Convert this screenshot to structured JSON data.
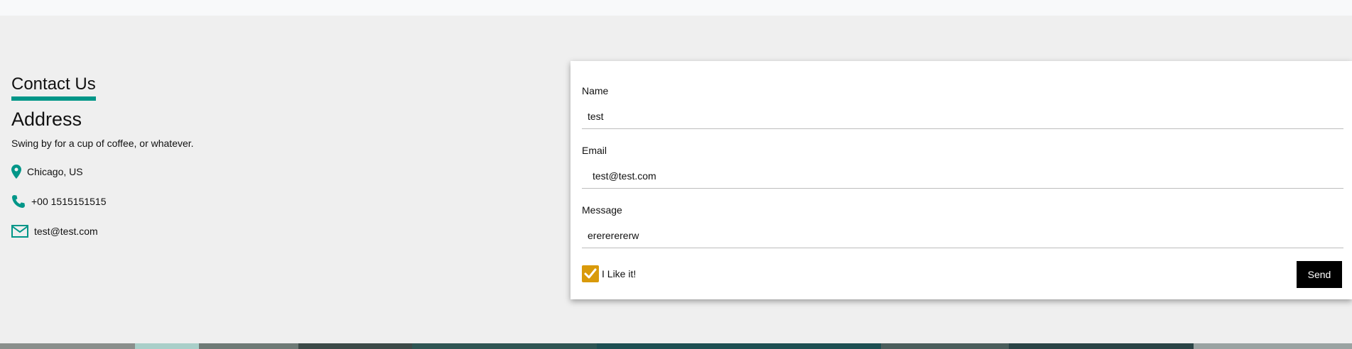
{
  "contact": {
    "title": "Contact Us",
    "address_heading": "Address",
    "address_text": "Swing by for a cup of coffee, or whatever.",
    "location": "Chicago, US",
    "phone": "+00 1515151515",
    "email": "test@test.com"
  },
  "form": {
    "name_label": "Name",
    "name_value": "test",
    "email_label": "Email",
    "email_value": "test@test.com",
    "message_label": "Message",
    "message_value": "erererererw",
    "checkbox_label": "I Like it!",
    "checkbox_checked": true,
    "send_label": "Send"
  },
  "colors": {
    "accent": "#009688",
    "checkbox": "#d99a0a",
    "button": "#000000"
  },
  "icons": {
    "location": "map-marker-icon",
    "phone": "phone-icon",
    "email": "envelope-icon",
    "check": "checkmark-icon"
  }
}
